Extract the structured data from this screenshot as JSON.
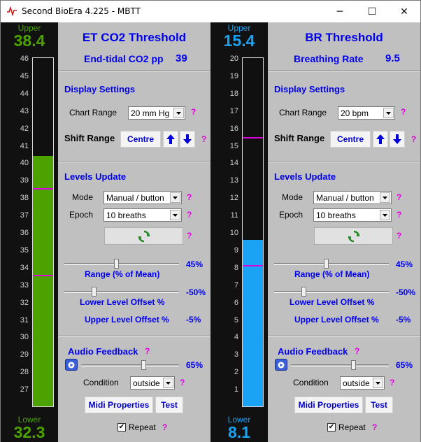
{
  "window": {
    "title": "Second BioEra 4.225 - MBTT",
    "minimize": "─",
    "maximize": "☐",
    "close": "✕"
  },
  "meters": [
    {
      "upper_label": "Upper",
      "upper_value": "38.4",
      "lower_label": "Lower",
      "lower_value": "32.3",
      "ticks": [
        "46",
        "45",
        "44",
        "43",
        "42",
        "41",
        "40",
        "39",
        "38",
        "37",
        "36",
        "35",
        "34",
        "33",
        "32",
        "31",
        "30",
        "29",
        "28",
        "27"
      ],
      "fill_color": "#4ca300",
      "fill_fraction": 0.718,
      "upper_marker_fraction": 0.627,
      "lower_marker_fraction": 0.378
    },
    {
      "upper_label": "Upper",
      "upper_value": "15.4",
      "lower_label": "Lower",
      "lower_value": "8.1",
      "ticks": [
        "20",
        "19",
        "18",
        "17",
        "16",
        "15",
        "14",
        "13",
        "12",
        "11",
        "10",
        "9",
        "8",
        "7",
        "6",
        "5",
        "4",
        "3",
        "2",
        "1"
      ],
      "fill_color": "#1aa3f5",
      "fill_fraction": 0.478,
      "upper_marker_fraction": 0.773,
      "lower_marker_fraction": 0.405
    }
  ],
  "panels": [
    {
      "title": "ET CO2 Threshold",
      "subtitle": "End-tidal CO2 pp",
      "subtitle_value": "39",
      "display_settings": "Display Settings",
      "chart_range_label": "Chart Range",
      "chart_range_value": "20 mm Hg",
      "shift_range_label": "Shift Range",
      "centre_label": "Centre",
      "levels_update": "Levels Update",
      "mode_label": "Mode",
      "mode_value": "Manual / button",
      "epoch_label": "Epoch",
      "epoch_value": "10 breaths",
      "range_caption": "Range (% of Mean)",
      "range_value": "45%",
      "range_fraction": 0.45,
      "lower_offset_caption": "Lower Level Offset %",
      "lower_offset_value": "-50%",
      "lower_offset_fraction": 0.25,
      "upper_offset_caption": "Upper Level Offset %",
      "upper_offset_value": "-5%",
      "audio_feedback": "Audio Feedback",
      "volume_value": "65%",
      "volume_fraction": 0.65,
      "condition_label": "Condition",
      "condition_value": "outside",
      "midi_label": "Midi Properties",
      "test_label": "Test",
      "repeat_label": "Repeat",
      "repeat_checked": "✔"
    },
    {
      "title": "BR Threshold",
      "subtitle": "Breathing Rate",
      "subtitle_value": "9.5",
      "display_settings": "Display Settings",
      "chart_range_label": "Chart Range",
      "chart_range_value": "20 bpm",
      "shift_range_label": "Shift Range",
      "centre_label": "Centre",
      "levels_update": "Levels Update",
      "mode_label": "Mode",
      "mode_value": "Manual / button",
      "epoch_label": "Epoch",
      "epoch_value": "10 breaths",
      "range_caption": "Range (% of Mean)",
      "range_value": "45%",
      "range_fraction": 0.45,
      "lower_offset_caption": "Lower Level Offset %",
      "lower_offset_value": "-50%",
      "lower_offset_fraction": 0.25,
      "upper_offset_caption": "Upper Level Offset %",
      "upper_offset_value": "-5%",
      "audio_feedback": "Audio Feedback",
      "volume_value": "65%",
      "volume_fraction": 0.65,
      "condition_label": "Condition",
      "condition_value": "outside",
      "midi_label": "Midi Properties",
      "test_label": "Test",
      "repeat_label": "Repeat",
      "repeat_checked": "✔"
    }
  ],
  "help_mark": "?"
}
